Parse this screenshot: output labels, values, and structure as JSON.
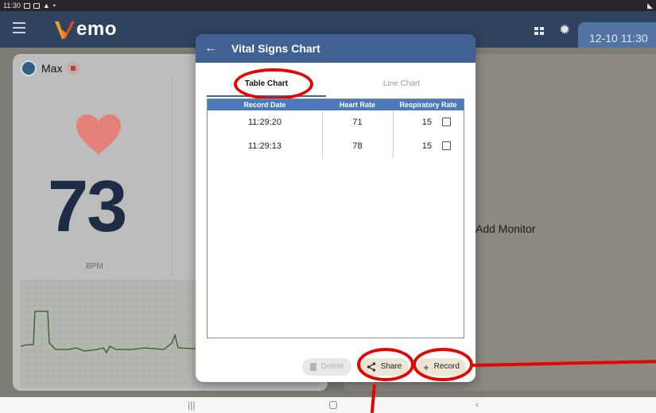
{
  "status_bar": {
    "time": "11:30",
    "indicators": [
      "image-icon",
      "message-icon",
      "warning-icon",
      "dot"
    ]
  },
  "app_bar": {
    "logo_text": "emo",
    "datetime": "12-10 11:30"
  },
  "monitor": {
    "patient_name": "Max",
    "heart_rate_value": "73",
    "heart_rate_unit": "BPM",
    "add_monitor_label": "Add Monitor"
  },
  "dialog": {
    "title": "Vital Signs Chart",
    "tabs": [
      {
        "label": "Table Chart",
        "selected": true
      },
      {
        "label": "Line Chart",
        "selected": false
      }
    ],
    "table": {
      "headers": [
        "Record Date",
        "Heart Rate",
        "Respiratory Rate"
      ],
      "rows": [
        {
          "time": "11:29:20",
          "heart_rate": "71",
          "respiratory_rate": "15",
          "checked": false
        },
        {
          "time": "11:29:13",
          "heart_rate": "78",
          "respiratory_rate": "15",
          "checked": false
        }
      ]
    },
    "actions": {
      "delete_label": "Delete",
      "share_label": "Share",
      "record_label": "Record"
    }
  },
  "colors": {
    "app_bar": "#30435e",
    "dialog_header": "#3f6193",
    "table_header": "#4b79bc",
    "annotation": "#e10600",
    "heart": "#e8817c"
  }
}
